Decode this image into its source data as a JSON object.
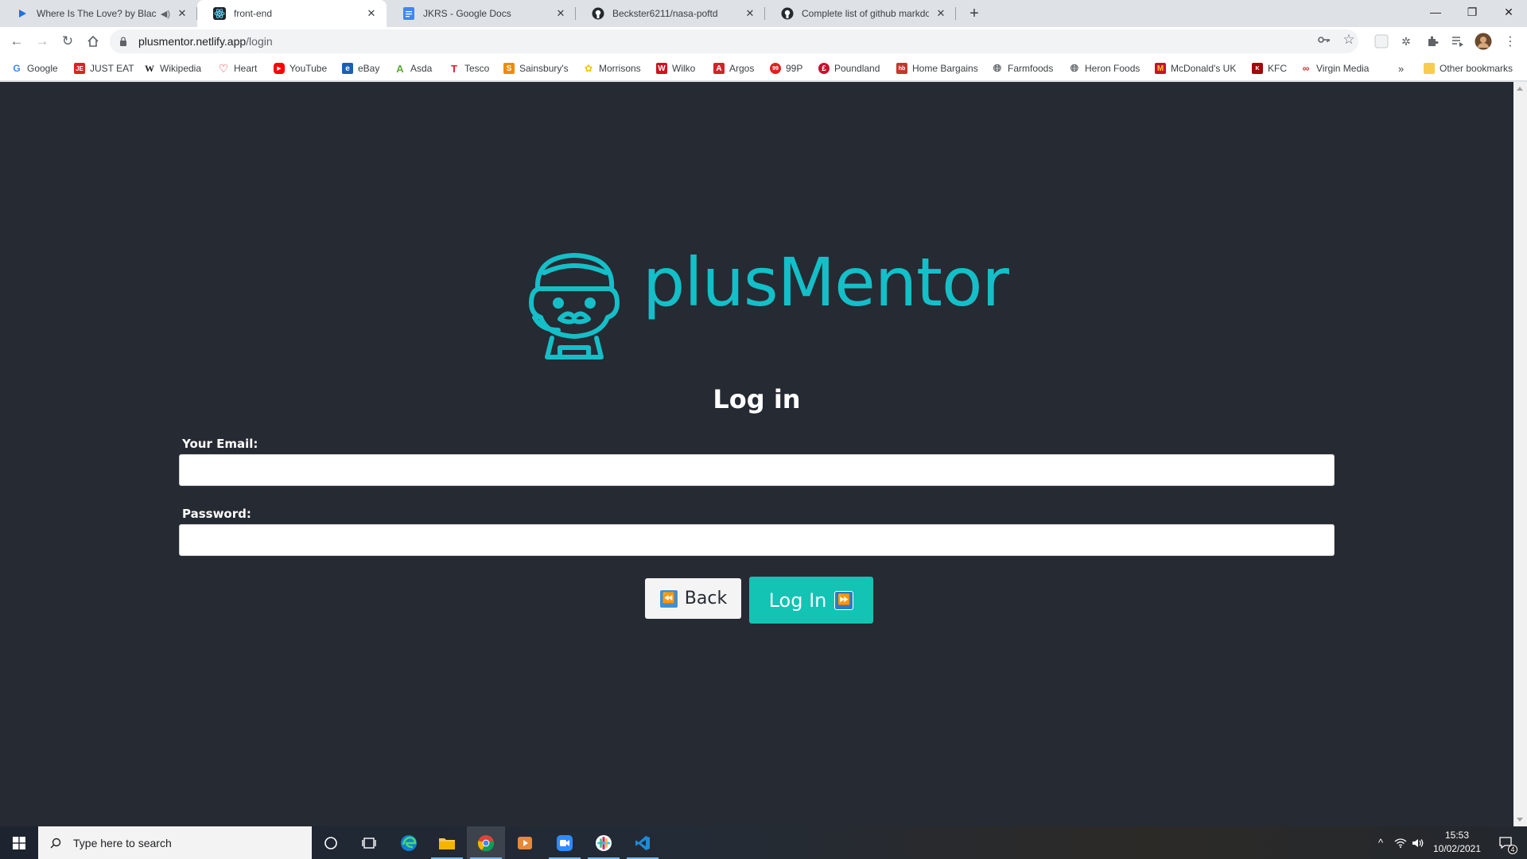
{
  "tabs": [
    {
      "title": "Where Is The Love? by Black",
      "icon": "music-player-icon",
      "audio": true
    },
    {
      "title": "front-end",
      "icon": "react-icon",
      "active": true
    },
    {
      "title": "JKRS - Google Docs",
      "icon": "google-docs-icon"
    },
    {
      "title": "Beckster6211/nasa-poftd",
      "icon": "github-icon"
    },
    {
      "title": "Complete list of github markdow",
      "icon": "github-icon"
    }
  ],
  "address_bar": {
    "host": "plusmentor.netlify.app",
    "path": "/login"
  },
  "bookmarks": [
    {
      "label": "Google",
      "icon": "google-icon",
      "color": "#4285f4"
    },
    {
      "label": "JUST EAT",
      "icon": "just-eat-icon",
      "color": "#e02020"
    },
    {
      "label": "Wikipedia",
      "icon": "wikipedia-icon",
      "color": "#202124"
    },
    {
      "label": "Heart",
      "icon": "heart-radio-icon",
      "color": "#e0202a"
    },
    {
      "label": "YouTube",
      "icon": "youtube-icon",
      "color": "#ff0000"
    },
    {
      "label": "eBay",
      "icon": "ebay-icon",
      "color": "#1a5fb4"
    },
    {
      "label": "Asda",
      "icon": "asda-icon",
      "color": "#5aa832"
    },
    {
      "label": "Tesco",
      "icon": "tesco-icon",
      "color": "#e01a2d"
    },
    {
      "label": "Sainsbury's",
      "icon": "sainsburys-icon",
      "color": "#f28a00"
    },
    {
      "label": "Morrisons",
      "icon": "morrisons-icon",
      "color": "#f5c300"
    },
    {
      "label": "Wilko",
      "icon": "wilko-icon",
      "color": "#d0101f"
    },
    {
      "label": "Argos",
      "icon": "argos-icon",
      "color": "#d2232a"
    },
    {
      "label": "99P",
      "icon": "99p-icon",
      "color": "#e02020"
    },
    {
      "label": "Poundland",
      "icon": "poundland-icon",
      "color": "#c8102e"
    },
    {
      "label": "Home Bargains",
      "icon": "home-bargains-icon",
      "color": "#c0392b"
    },
    {
      "label": "Farmfoods",
      "icon": "globe-icon",
      "color": "#5f6368"
    },
    {
      "label": "Heron Foods",
      "icon": "globe-icon",
      "color": "#5f6368"
    },
    {
      "label": "McDonald's UK",
      "icon": "mcdonalds-icon",
      "color": "#c8102e"
    },
    {
      "label": "KFC",
      "icon": "kfc-icon",
      "color": "#a3080c"
    },
    {
      "label": "Virgin Media",
      "icon": "virgin-media-icon",
      "color": "#e01a2d"
    }
  ],
  "bookmarks_overflow": "»",
  "other_bookmarks": "Other bookmarks",
  "page": {
    "brand": "plusMentor",
    "brand_color": "#14bfc8",
    "background": "#262a33",
    "heading": "Log in",
    "email_label": "Your Email:",
    "email_value": "",
    "password_label": "Password:",
    "password_value": "",
    "back_button": "Back",
    "back_arrow": "⏪",
    "login_button": "Log In",
    "login_arrow": "⏩",
    "accent": "#13c3b4"
  },
  "taskbar": {
    "search_placeholder": "Type here to search",
    "apps": [
      "cortana-icon",
      "task-view-icon",
      "edge-icon",
      "file-explorer-icon",
      "chrome-icon",
      "media-player-icon",
      "zoom-icon",
      "slack-icon",
      "vscode-icon"
    ],
    "time": "15:53",
    "date": "10/02/2021",
    "notifications": "4"
  }
}
